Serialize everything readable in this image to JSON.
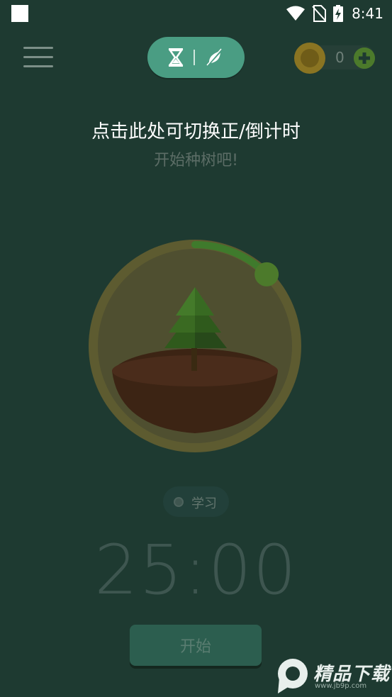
{
  "status_bar": {
    "time": "8:41",
    "icons": [
      "wifi-icon",
      "no-sim-icon",
      "battery-charging-icon"
    ]
  },
  "top_bar": {
    "menu_icon": "hamburger-icon",
    "mode_toggle": {
      "left_icon": "hourglass-icon",
      "right_icon": "no-deep-focus-icon"
    },
    "coins": {
      "icon": "coin-icon",
      "count": "0",
      "add_icon": "plus-icon"
    }
  },
  "hint": {
    "switch_text": "点击此处可切换正/倒计时",
    "subtitle": "开始种树吧!"
  },
  "tree": {
    "icon": "pine-tree-icon",
    "progress_fraction": 0.125
  },
  "tag": {
    "label": "学习"
  },
  "timer": {
    "value": "25:00"
  },
  "start_button": {
    "label": "开始"
  },
  "watermark": {
    "text": "精品下载",
    "url": "www.jb9p.com"
  },
  "colors": {
    "background": "#1e3a31",
    "toggle": "#4a9d83",
    "progress": "#3f7a2c",
    "ring": "#6b6a3a",
    "soil": "#4a2c1b"
  }
}
